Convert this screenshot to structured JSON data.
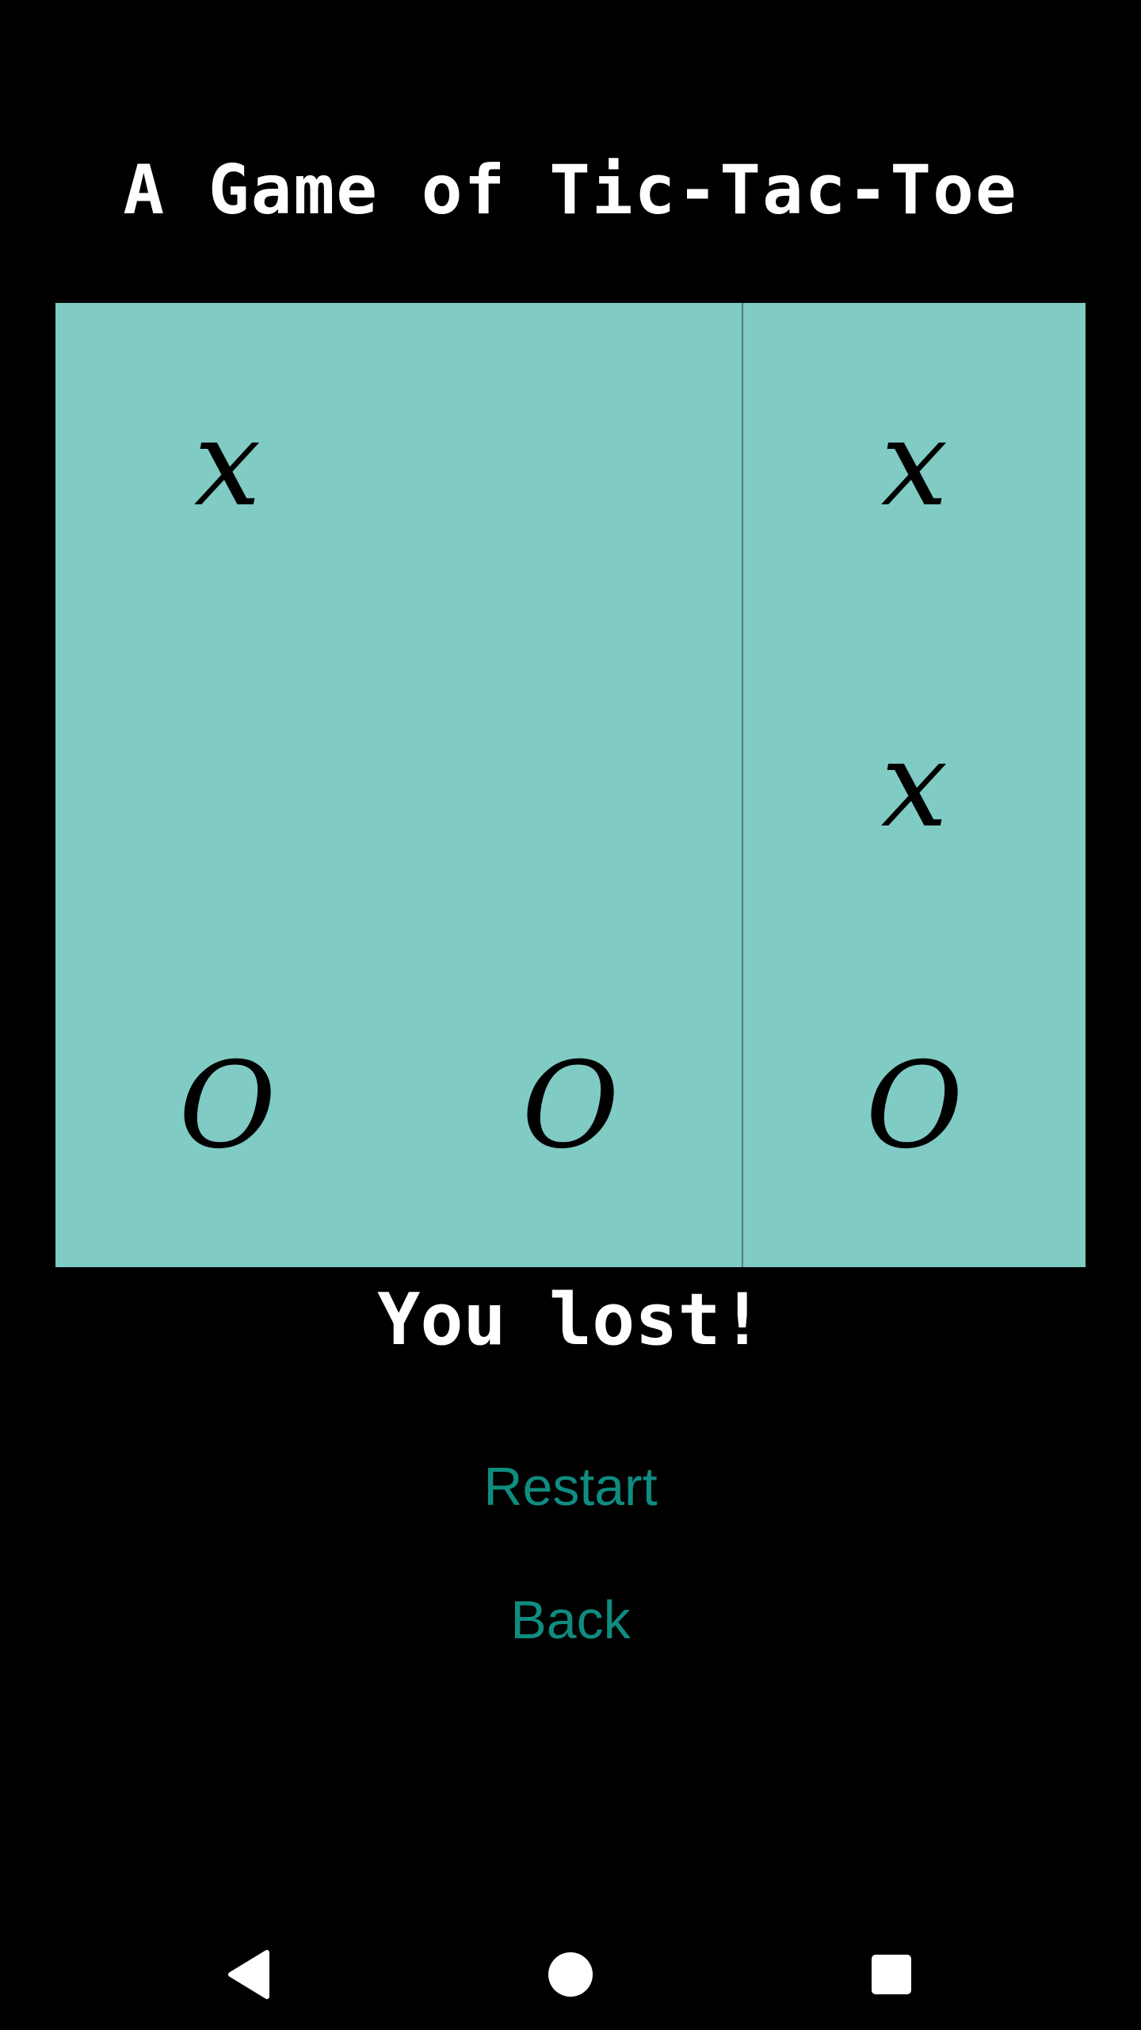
{
  "header": {
    "title": "A Game of Tic-Tac-Toe"
  },
  "board": {
    "cells": [
      [
        "x",
        "",
        "x"
      ],
      [
        "",
        "",
        "x"
      ],
      [
        "O",
        "O",
        "O"
      ]
    ],
    "background_color": "#80cbc4"
  },
  "status": {
    "text": "You lost!"
  },
  "actions": {
    "restart_label": "Restart",
    "back_label": "Back",
    "link_color": "#0f8c80"
  },
  "navbar": {
    "icons": [
      "back-triangle-icon",
      "home-circle-icon",
      "recent-apps-square-icon"
    ]
  }
}
